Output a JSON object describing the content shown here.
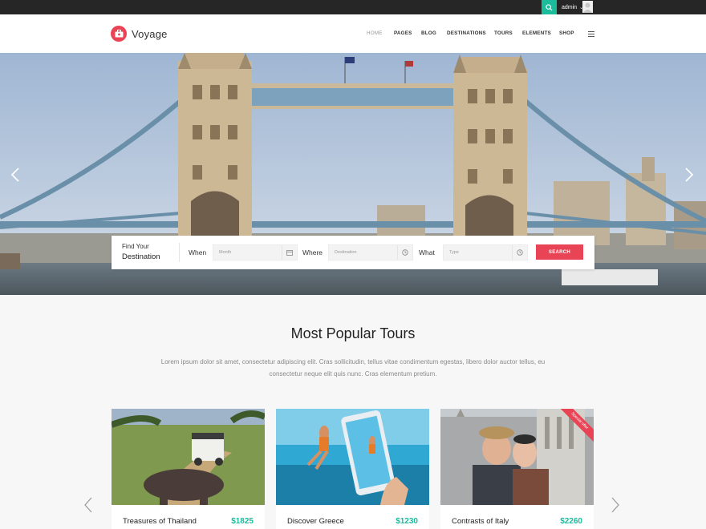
{
  "topbar": {
    "user": "admin"
  },
  "brand": {
    "name": "Voyage",
    "accent": "#e84455",
    "teal": "#1abc9c"
  },
  "nav": [
    {
      "label": "HOME",
      "active": true
    },
    {
      "label": "PAGES"
    },
    {
      "label": "BLOG"
    },
    {
      "label": "DESTINATIONS"
    },
    {
      "label": "TOURS"
    },
    {
      "label": "ELEMENTS"
    },
    {
      "label": "SHOP"
    }
  ],
  "search": {
    "title_line1": "Find Your",
    "title_line2": "Destination",
    "when_label": "When",
    "when_placeholder": "Month",
    "where_label": "Where",
    "where_placeholder": "Destination",
    "what_label": "What",
    "what_placeholder": "Type",
    "button": "SEARCH"
  },
  "section": {
    "title": "Most Popular Tours",
    "description": "Lorem ipsum dolor sit amet, consectetur adipiscing elit. Cras sollicitudin, tellus vitae condimentum egestas, libero dolor auctor tellus, eu consectetur neque elit quis nunc. Cras elementum pretium."
  },
  "tours": [
    {
      "name": "Treasures of Thailand",
      "price": "$1825"
    },
    {
      "name": "Discover Greece",
      "price": "$1230"
    },
    {
      "name": "Contrasts of Italy",
      "price": "$2260",
      "ribbon": "Special offer"
    }
  ]
}
